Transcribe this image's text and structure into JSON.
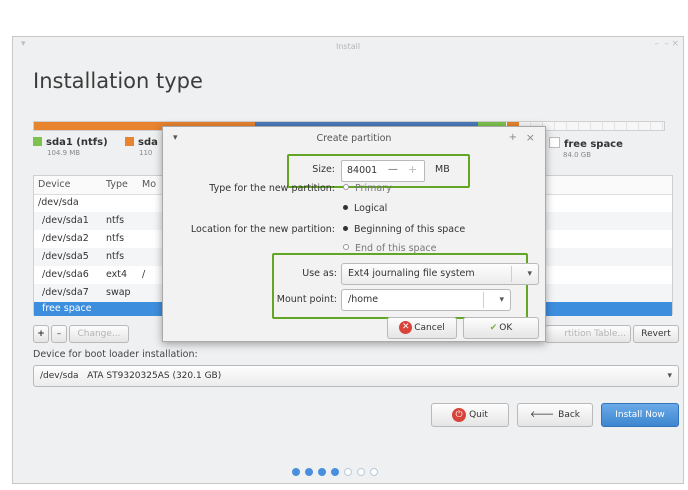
{
  "window": {
    "title": "Install",
    "controls": [
      "–",
      "–",
      "×"
    ],
    "heading": "Installation type"
  },
  "colors": {
    "ntfs": "#e8832e",
    "ext4": "#4a7bbd",
    "swap": "#7ec24e",
    "free": "#f4f4f4",
    "accent_green": "#63a524",
    "selection": "#3d8fde"
  },
  "legend": [
    {
      "name": "sda1 (ntfs)",
      "size": "104.9 MB",
      "color": "#7ec24e"
    },
    {
      "name": "sda",
      "size": "110",
      "color": "#e8832e"
    },
    {
      "name": "free space",
      "size": "84.0 GB",
      "color": "#ffffff"
    }
  ],
  "table": {
    "headers": [
      "Device",
      "Type",
      "Mo"
    ],
    "rows": [
      {
        "device": "/dev/sda",
        "type": "",
        "mount": ""
      },
      {
        "device": "/dev/sda1",
        "type": "ntfs",
        "mount": ""
      },
      {
        "device": "/dev/sda2",
        "type": "ntfs",
        "mount": ""
      },
      {
        "device": "/dev/sda5",
        "type": "ntfs",
        "mount": ""
      },
      {
        "device": "/dev/sda6",
        "type": "ext4",
        "mount": "/"
      },
      {
        "device": "/dev/sda7",
        "type": "swap",
        "mount": ""
      },
      {
        "device": "free space",
        "type": "",
        "mount": ""
      }
    ]
  },
  "table_buttons": {
    "add": "+",
    "remove": "–",
    "change": "Change...",
    "new_table": "rtition Table...",
    "revert": "Revert"
  },
  "bootloader": {
    "label": "Device for boot loader installation:",
    "value": "/dev/sda   ATA ST9320325AS (320.1 GB)"
  },
  "actions": {
    "quit": "Quit",
    "back": "Back",
    "install_now": "Install Now"
  },
  "progress": {
    "total": 7,
    "done": 4
  },
  "dialog": {
    "title": "Create partition",
    "menu_glyph": "▾",
    "plus_glyph": "+",
    "close_glyph": "×",
    "size_label": "Size:",
    "size_value": "84001",
    "minus": "—",
    "plus": "+",
    "unit": "MB",
    "type_label": "Type for the new partition:",
    "type_primary": "Primary",
    "type_logical": "Logical",
    "location_label": "Location for the new partition:",
    "location_beginning": "Beginning of this space",
    "location_end": "End of this space",
    "use_as_label": "Use as:",
    "use_as_value": "Ext4 journaling file system",
    "mount_label": "Mount point:",
    "mount_value": "/home",
    "cancel": "Cancel",
    "ok": "OK"
  }
}
